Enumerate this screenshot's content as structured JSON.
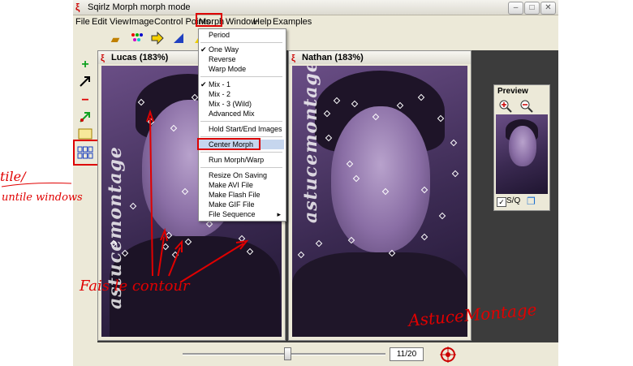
{
  "window": {
    "title": "Sqirlz Morph   morph mode",
    "min": "–",
    "max": "□",
    "close": "✕"
  },
  "menu": [
    "File",
    "Edit",
    "View",
    "Image",
    "Control Points",
    "Morph",
    "Window",
    "Help",
    "Examples"
  ],
  "morph_menu": {
    "items": [
      "Period",
      "One Way",
      "Reverse",
      "Warp Mode",
      "Mix - 1",
      "Mix - 2",
      "Mix - 3 (Wild)",
      "Advanced Mix",
      "Hold Start/End Images",
      "Center Morph",
      "Run Morph/Warp",
      "Resize On Saving",
      "Make AVI File",
      "Make Flash File",
      "Make GIF File",
      "File Sequence"
    ],
    "checked": [
      "One Way",
      "Mix - 1"
    ],
    "highlighted": "Center Morph",
    "submenu_arrow": "▸"
  },
  "left_window": {
    "title": "Lucas (183%)"
  },
  "right_window": {
    "title": "Nathan (183%)"
  },
  "watermark": "astucemontage",
  "preview": {
    "title": "Preview",
    "checkbox_label": "S/Q"
  },
  "frame_counter": "11/20",
  "annotations": {
    "tile": "tile/",
    "untile": "untile windows",
    "contour": "Fais le contour",
    "signature": "AstuceMontage"
  },
  "colors": {
    "highlight": "#d00000",
    "menu_selected": "#c6d6ee",
    "workspace": "#3c3c3c"
  }
}
